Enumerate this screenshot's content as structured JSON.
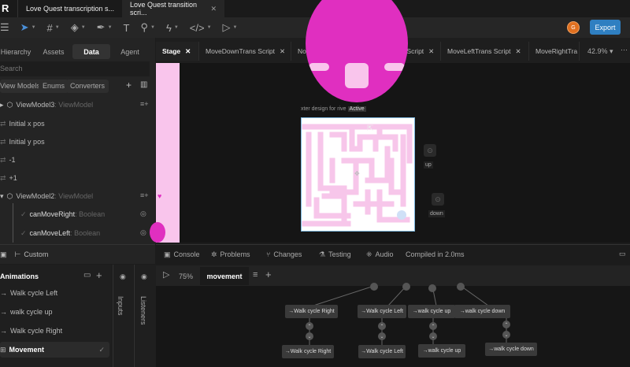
{
  "title_tabs": [
    {
      "label": "Love Quest transcription s..."
    },
    {
      "label": "Love Quest transition scri..."
    }
  ],
  "toolbar": {
    "avatar_letter": "G",
    "export_label": "Export"
  },
  "left_tabs": [
    "Hierarchy",
    "Assets",
    "Data",
    "Agent"
  ],
  "search_placeholder": "Search",
  "data_buttons": [
    "View Models",
    "Enums",
    "Converters"
  ],
  "tree": [
    {
      "name": "ViewModel3",
      "type": ": ViewModel"
    },
    {
      "name": "Initial x pos"
    },
    {
      "name": "Initial y pos"
    },
    {
      "name": "-1"
    },
    {
      "name": "+1"
    },
    {
      "name": "ViewModel2",
      "type": ": ViewModel"
    },
    {
      "name": "canMoveRight",
      "type": ": Boolean"
    },
    {
      "name": "canMoveLeft",
      "type": ": Boolean"
    }
  ],
  "custom_label": "Custom",
  "animations": {
    "title": "Animations",
    "items": [
      "Walk cycle Left",
      "walk cycle up",
      "Walk cycle Right",
      "Movement"
    ],
    "inputs_label": "Inputs",
    "listeners_label": "Listeners"
  },
  "center_tabs": [
    "Stage",
    "MoveDownTrans Script",
    "Node Script 1",
    "MoveUpTrans Script",
    "MoveLeftTrans Script",
    "MoveRightTra"
  ],
  "zoom": "42.9%",
  "artboard": {
    "label": "xter design for rive",
    "badge": "Active"
  },
  "stage_buttons": [
    "up",
    "down"
  ],
  "bottom_tabs": [
    "Console",
    "Problems",
    "Changes",
    "Testing",
    "Audio"
  ],
  "compiled": "Compiled in 2.0ms",
  "state_machine": {
    "speed": "75%",
    "tab": "movement",
    "top_nodes": [
      "Walk cycle Right",
      "Walk cycle Left",
      "walk cycle up",
      "walk cycle down"
    ],
    "bottom_nodes": [
      "Walk cycle Right",
      "Walk cycle Left",
      "walk cycle up",
      "walk cycle down"
    ]
  },
  "colors": {
    "accent": "#2f7fc1",
    "pink": "#e02fc0",
    "maze": "#f7c6ea"
  }
}
